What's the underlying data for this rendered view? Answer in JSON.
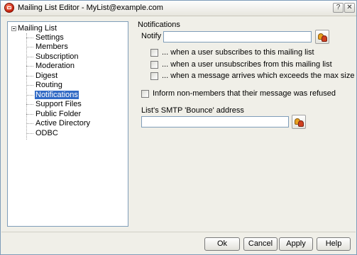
{
  "window": {
    "title": "Mailing List Editor - MyList@example.com",
    "help_glyph": "?",
    "close_glyph": "✕"
  },
  "tree": {
    "root": "Mailing List",
    "items": [
      "Settings",
      "Members",
      "Subscription",
      "Moderation",
      "Digest",
      "Routing",
      "Notifications",
      "Support Files",
      "Public Folder",
      "Active Directory",
      "ODBC"
    ],
    "selected": "Notifications"
  },
  "notifications": {
    "group_label": "Notifications",
    "notify_label": "Notify",
    "notify_value": "",
    "checkboxes": [
      {
        "label": "... when a user subscribes to this mailing list",
        "checked": false
      },
      {
        "label": "... when a user unsubscribes from this mailing list",
        "checked": false
      },
      {
        "label": "... when a message arrives which exceeds the max size limit",
        "checked": false
      }
    ],
    "inform_label": "Inform non-members that their message was refused",
    "inform_checked": false,
    "smtp_label": "List's SMTP 'Bounce' address",
    "smtp_value": ""
  },
  "buttons": {
    "ok": "Ok",
    "cancel": "Cancel",
    "apply": "Apply",
    "help": "Help"
  }
}
